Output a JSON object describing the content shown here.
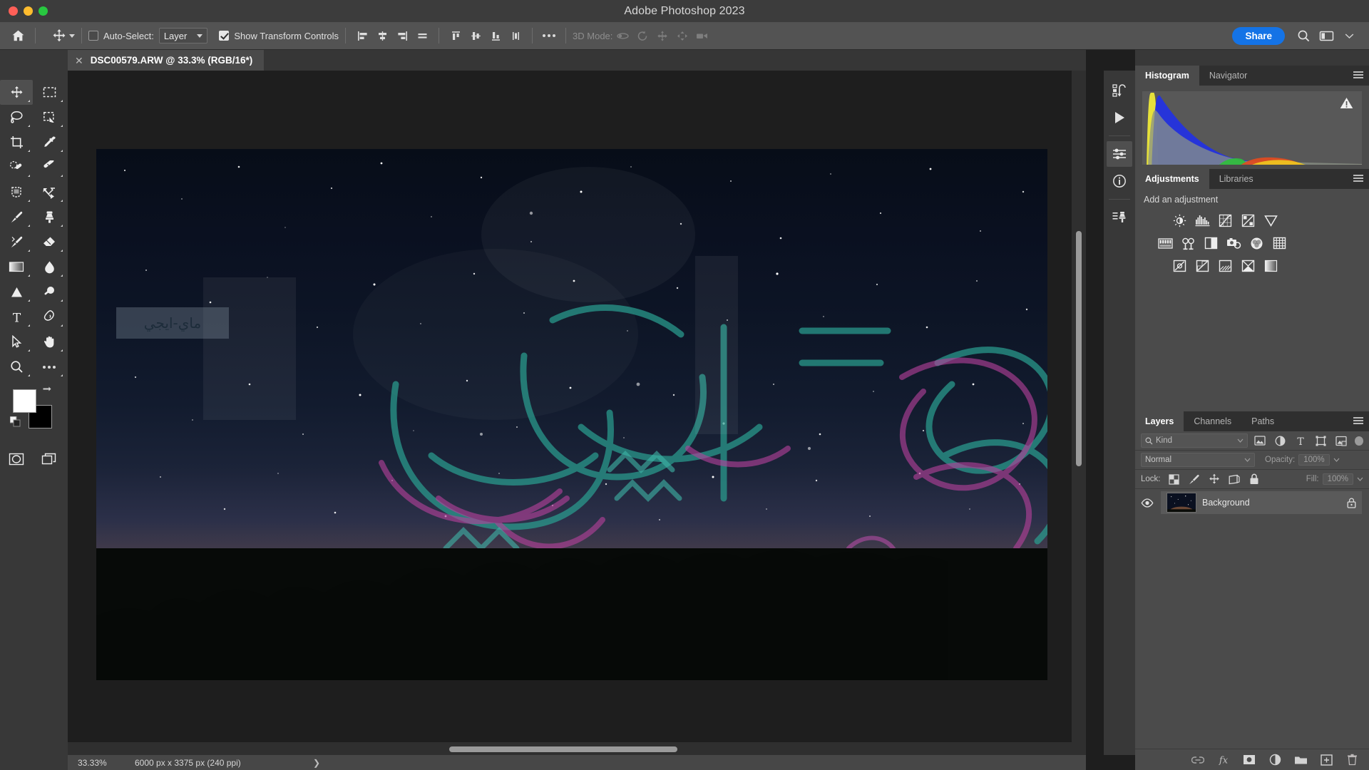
{
  "window": {
    "title": "Adobe Photoshop 2023",
    "traffic_lights": [
      "close",
      "minimize",
      "maximize"
    ]
  },
  "options_bar": {
    "home_icon": "home-icon",
    "active_tool_icon": "move-tool-icon",
    "auto_select_label": "Auto-Select:",
    "auto_select_checked": false,
    "auto_select_value": "Layer",
    "show_transform_label": "Show Transform Controls",
    "show_transform_checked": true,
    "align_icons": [
      "align-left-edges-icon",
      "align-horizontal-centers-icon",
      "align-right-edges-icon",
      "align-top-edges-icon"
    ],
    "distribute_icons": [
      "distribute-top-edges-icon",
      "distribute-vertical-centers-icon",
      "distribute-bottom-edges-icon",
      "distribute-widths-icon"
    ],
    "more_icon": "more-options-icon",
    "three_d_mode_label": "3D Mode:",
    "three_d_icons": [
      "orbit-3d-icon",
      "roll-3d-icon",
      "pan-3d-icon",
      "slide-3d-icon",
      "camera-3d-icon"
    ],
    "share_label": "Share",
    "search_icon": "search-icon",
    "workspace_icon": "workspace-layout-icon",
    "workspace_caret": "chevron-down-icon"
  },
  "document_tab": {
    "close_icon": "close-icon",
    "title": "DSC00579.ARW @ 33.3% (RGB/16*)"
  },
  "toolbar": {
    "collapse_left": "«",
    "collapse_right": "»",
    "tools": [
      {
        "name": "move-tool",
        "active": true
      },
      {
        "name": "rectangular-marquee-tool",
        "active": false
      },
      {
        "name": "lasso-tool",
        "active": false
      },
      {
        "name": "object-selection-tool",
        "active": false
      },
      {
        "name": "crop-tool",
        "active": false
      },
      {
        "name": "eyedropper-tool",
        "active": false
      },
      {
        "name": "spot-healing-brush-tool",
        "active": false
      },
      {
        "name": "healing-brush-tool",
        "active": false
      },
      {
        "name": "patch-tool",
        "active": false
      },
      {
        "name": "content-aware-move-tool",
        "active": false
      },
      {
        "name": "brush-tool",
        "active": false
      },
      {
        "name": "clone-stamp-tool",
        "active": false
      },
      {
        "name": "history-brush-tool",
        "active": false
      },
      {
        "name": "eraser-tool",
        "active": false
      },
      {
        "name": "gradient-tool",
        "active": false
      },
      {
        "name": "blur-tool",
        "active": false
      },
      {
        "name": "dodge-tool",
        "active": false
      },
      {
        "name": "burn-tool",
        "active": false
      },
      {
        "name": "type-tool",
        "active": false
      },
      {
        "name": "pen-tool",
        "active": false
      },
      {
        "name": "path-selection-tool",
        "active": false
      },
      {
        "name": "hand-tool",
        "active": false
      },
      {
        "name": "zoom-tool",
        "active": false
      },
      {
        "name": "edit-toolbar-tool",
        "active": false
      }
    ],
    "foreground_color": "#ffffff",
    "background_color": "#000000",
    "swap_colors_icon": "swap-colors-icon",
    "default_colors_icon": "default-colors-icon",
    "quick_mask_icon": "quick-mask-icon",
    "screen_mode_icon": "screen-mode-icon"
  },
  "canvas": {
    "image_name": "night-sky-milky-way-photo",
    "watermark_text": "ماي-ايجي",
    "overlay_colors": [
      "#2a9d8f",
      "#b5419b"
    ]
  },
  "status_bar": {
    "zoom": "33.33%",
    "dimensions": "6000 px x 3375 px (240 ppi)",
    "expand_icon": "chevron-right-icon"
  },
  "dock_rail": {
    "icons": [
      {
        "name": "history-icon",
        "active": false
      },
      {
        "name": "actions-play-icon",
        "active": false
      },
      {
        "name": "properties-icon",
        "active": true
      },
      {
        "name": "info-icon",
        "active": false
      },
      {
        "name": "clone-source-icon",
        "active": false
      }
    ]
  },
  "histogram_panel": {
    "tabs": [
      {
        "label": "Histogram",
        "active": true
      },
      {
        "label": "Navigator",
        "active": false
      }
    ],
    "menu_icon": "panel-menu-icon",
    "warning_icon": "uncached-data-warning-icon"
  },
  "adjustments_panel": {
    "tabs": [
      {
        "label": "Adjustments",
        "active": true
      },
      {
        "label": "Libraries",
        "active": false
      }
    ],
    "menu_icon": "panel-menu-icon",
    "heading": "Add an adjustment",
    "row1": [
      "brightness-contrast-icon",
      "levels-icon",
      "curves-icon",
      "exposure-icon",
      "vibrance-icon"
    ],
    "row2": [
      "hue-saturation-icon",
      "color-balance-icon",
      "black-and-white-icon",
      "photo-filter-icon",
      "channel-mixer-icon",
      "color-lookup-icon"
    ],
    "row3": [
      "invert-icon",
      "posterize-icon",
      "threshold-icon",
      "selective-color-icon",
      "gradient-map-icon"
    ]
  },
  "layers_panel": {
    "tabs": [
      {
        "label": "Layers",
        "active": true
      },
      {
        "label": "Channels",
        "active": false
      },
      {
        "label": "Paths",
        "active": false
      }
    ],
    "menu_icon": "panel-menu-icon",
    "filter_placeholder": "Kind",
    "filter_search_icon": "search-icon",
    "filter_icons": [
      "filter-pixel-icon",
      "filter-adjustment-icon",
      "filter-type-icon",
      "filter-shape-icon",
      "filter-smart-object-icon"
    ],
    "filter_toggle": "filter-enable-toggle",
    "blend_mode": "Normal",
    "opacity_label": "Opacity:",
    "opacity_value": "100%",
    "lock_label": "Lock:",
    "lock_icons": [
      "lock-transparent-pixels-icon",
      "lock-image-pixels-icon",
      "lock-position-icon",
      "lock-artboard-nesting-icon",
      "lock-all-icon"
    ],
    "fill_label": "Fill:",
    "fill_value": "100%",
    "layers": [
      {
        "name": "Background",
        "visible": true,
        "locked": true,
        "visibility_icon": "eye-icon",
        "lock_icon": "lock-icon",
        "thumbnail": "background-layer-thumbnail"
      }
    ],
    "footer_icons": [
      "link-layers-icon",
      "add-layer-style-fx-icon",
      "add-layer-mask-icon",
      "new-adjustment-layer-icon",
      "new-group-icon",
      "new-layer-icon",
      "delete-layer-icon"
    ]
  }
}
